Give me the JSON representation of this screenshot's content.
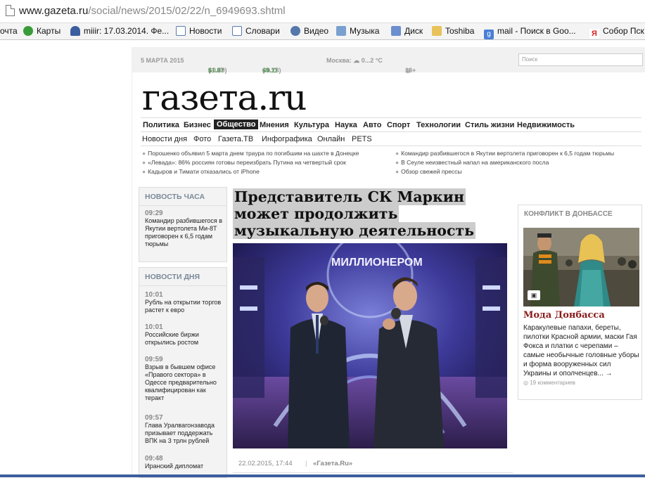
{
  "browser": {
    "url_host": "www.gazeta.ru",
    "url_path": "/social/news/2015/02/22/n_6949693.shtml"
  },
  "bookmarks": [
    {
      "label": "очта",
      "icon": "none"
    },
    {
      "label": "Карты",
      "icon": "maps-icon"
    },
    {
      "label": "miiir: 17.03.2014. Фе...",
      "icon": "user-icon"
    },
    {
      "label": "Новости",
      "icon": "page-icon"
    },
    {
      "label": "Словари",
      "icon": "page-icon"
    },
    {
      "label": "Видео",
      "icon": "video-icon"
    },
    {
      "label": "Музыка",
      "icon": "music-icon"
    },
    {
      "label": "Диск",
      "icon": "mail-icon"
    },
    {
      "label": "Toshiba",
      "icon": "folder-icon"
    },
    {
      "label": "mail - Поиск в Goo...",
      "icon": "google-icon"
    },
    {
      "label": "Собор Пск",
      "icon": "yandex-icon"
    }
  ],
  "topbar": {
    "date": "5 МАРТА 2015",
    "usd": "61.87",
    "usd_change": "(-0.49)",
    "eur": "69.11",
    "eur_change": "(-0.73)",
    "weather": "Москва: ☁ 0...2 °C",
    "age": "18+",
    "search_placeholder": "Поиск"
  },
  "logo": "газета.ru",
  "nav_main": [
    "Политика",
    "Бизнес",
    "Общество",
    "Мнения",
    "Культура",
    "Наука",
    "Авто",
    "Спорт",
    "Технологии",
    "Стиль жизни",
    "Недвижимость"
  ],
  "nav_active": "Общество",
  "nav_sub": [
    "Новости дня",
    "Фото",
    "Газета.ТВ",
    "Инфографика",
    "Онлайн",
    "PETS"
  ],
  "ticker": [
    "Порошенко объявил 5 марта днем траура по погибшим на шахте в Донецке",
    "«Левада»: 86% россиян готовы переизбрать Путина на четвертый срок",
    "Кадыров и Тимати отказались от iPhone",
    "Командир разбившегося в Якутии вертолета приговорен к 6,5 годам тюрьмы",
    "В Сеуле неизвестный напал на американского посла",
    "Обзор свежей прессы"
  ],
  "hour_news": {
    "title": "НОВОСТЬ ЧАСА",
    "time": "09:29",
    "text": "Командир разбившегося в Якутии вертолета Ми-8Т приговорен к 6,5 годам тюрьмы"
  },
  "day_news": {
    "title": "НОВОСТИ ДНЯ",
    "items": [
      {
        "time": "10:01",
        "text": "Рубль на открытии торгов растет к евро"
      },
      {
        "time": "10:01",
        "text": "Российские биржи открылись ростом"
      },
      {
        "time": "09:59",
        "text": "Взрыв в бывшем офисе «Правого сектора» в Одессе предварительно квалифицирован как теракт"
      },
      {
        "time": "09:57",
        "text": "Глава Уралвагонзавода призывает поддержать ВПК на 3 трлн рублей"
      },
      {
        "time": "09:48",
        "text": "Иранский дипломат"
      }
    ]
  },
  "article": {
    "headline": "Представитель СК Маркин может продолжить музыкальную деятельность",
    "video_sign": "МИЛЛИОНЕРОМ",
    "date": "22.02.2015, 17:44",
    "source": "«Газета.Ru»"
  },
  "conflict": {
    "title": "КОНФЛИКТ В ДОНБАССЕ",
    "caption_title": "Мода Донбасса",
    "caption_text": "Каракулевые папахи, береты, пилотки Красной армии, маски Гая Фокса и платки с черепами – самые необычные головные уборы и форма вооруженных сил Украины и ополченцев... →",
    "comments": "19 комментариев"
  },
  "colors": {
    "accent_red": "#8b1a1a",
    "usd_green": "#2a8a2a",
    "nav_active_bg": "#222222"
  }
}
